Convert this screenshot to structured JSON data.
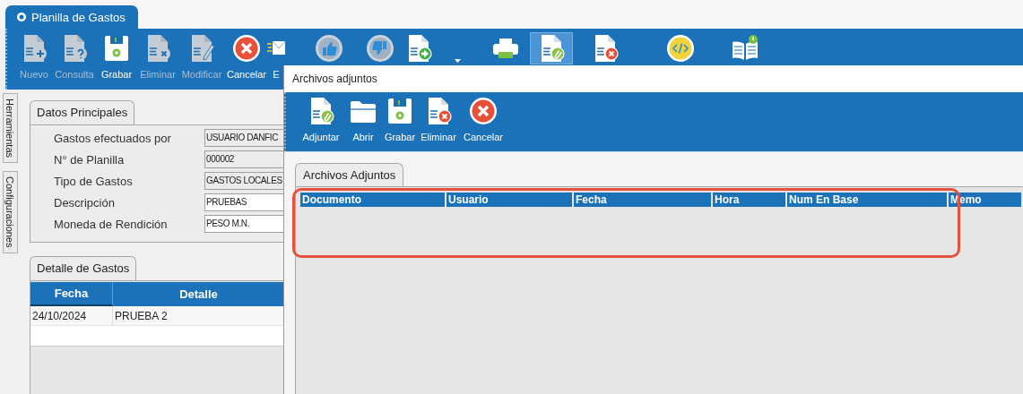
{
  "app_tab": {
    "title": "Planilla de Gastos"
  },
  "toolbar": [
    {
      "label": "Nuevo",
      "disabled": true,
      "selected": false
    },
    {
      "label": "Consulta",
      "disabled": true,
      "selected": false
    },
    {
      "label": "Grabar",
      "disabled": false,
      "selected": false
    },
    {
      "label": "Eliminar",
      "disabled": true,
      "selected": false
    },
    {
      "label": "Modificar",
      "disabled": true,
      "selected": false
    },
    {
      "label": "Cancelar",
      "disabled": false,
      "selected": false
    },
    {
      "label": "E",
      "disabled": false,
      "selected": false
    },
    {
      "disabled": true,
      "selected": false
    },
    {
      "disabled": true,
      "selected": false
    },
    {
      "disabled": false,
      "selected": false,
      "has_menu": true
    },
    {
      "disabled": false,
      "selected": false
    },
    {
      "disabled": false,
      "selected": true
    },
    {
      "disabled": false,
      "selected": false
    },
    {
      "disabled": false,
      "selected": false
    },
    {
      "disabled": false,
      "selected": false
    }
  ],
  "side_tabs": [
    {
      "label": "Herramientas"
    },
    {
      "label": "Configuraciones"
    }
  ],
  "datos_principales": {
    "tab": "Datos Principales",
    "fields": [
      {
        "label": "Gastos efectuados por",
        "value": "USUARIO DANFIC",
        "disabled": true
      },
      {
        "label": "N° de Planilla",
        "value": "000002",
        "disabled": true
      },
      {
        "label": "Tipo de Gastos",
        "value": "GASTOS LOCALES",
        "disabled": true
      },
      {
        "label": "Descripción",
        "value": "PRUEBAS",
        "disabled": false
      },
      {
        "label": "Moneda de Rendición",
        "value": "PESO M.N.",
        "disabled": false
      }
    ]
  },
  "detalle_de_gastos": {
    "tab": "Detalle de Gastos",
    "columns": [
      "Fecha",
      "Detalle"
    ],
    "rows": [
      {
        "cells": [
          "24/10/2024",
          "PRUEBA 2"
        ]
      }
    ]
  },
  "dialog": {
    "title": "Archivos adjuntos",
    "toolbar": [
      {
        "label": "Adjuntar"
      },
      {
        "label": "Abrir"
      },
      {
        "label": "Grabar"
      },
      {
        "label": "Eliminar"
      },
      {
        "label": "Cancelar"
      }
    ],
    "tab": "Archivos Adjuntos",
    "columns": [
      "Documento",
      "Usuario",
      "Fecha",
      "Hora",
      "Num En Base",
      "Memo"
    ]
  }
}
